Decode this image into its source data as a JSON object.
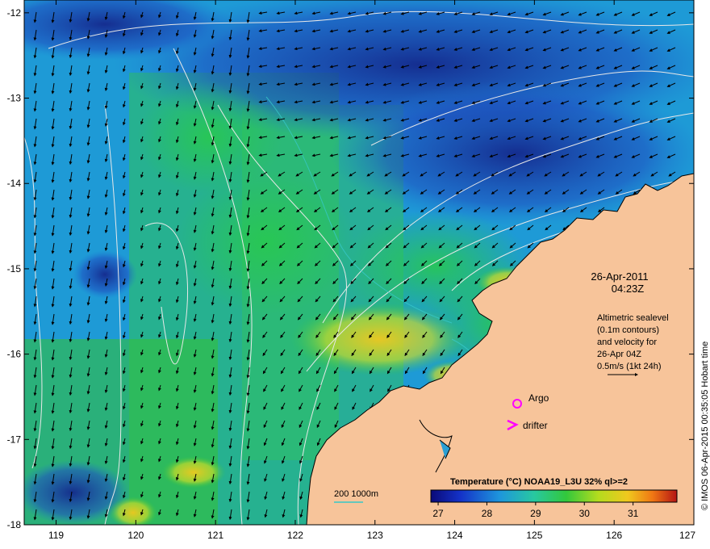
{
  "map": {
    "lon_ticks": [
      "119",
      "120",
      "121",
      "122",
      "123",
      "124",
      "125",
      "126",
      "127"
    ],
    "lat_ticks": [
      "-12",
      "-13",
      "-14",
      "-15",
      "-16",
      "-17",
      "-18"
    ],
    "lon_range": [
      118.6,
      127.0
    ],
    "lat_range": [
      -18.0,
      -11.85
    ]
  },
  "header": {
    "date": "26-Apr-2011",
    "time": "04:23Z"
  },
  "info": {
    "line1": "Altimetric sealevel",
    "line2": "(0.1m contours)",
    "line3": "and velocity for",
    "line4": "26-Apr 04Z",
    "line5": "0.5m/s (1kt 24h)"
  },
  "legend_markers": {
    "argo": "Argo",
    "drifter": "drifter"
  },
  "isobath": {
    "label": "200  1000m"
  },
  "colorbar": {
    "title": "Temperature (°C) NOAA19_L3U 32% ql>=2",
    "ticks": [
      "27",
      "28",
      "29",
      "30",
      "31"
    ],
    "range": [
      26.85,
      31.9
    ]
  },
  "stamp": {
    "text": "© IMOS 06-Apr-2015 00:35:05 Hobart time"
  },
  "colors": {
    "land": "#f7c49a",
    "sst_cold": "#14288c",
    "sst_mid": "#28b46e",
    "sst_warm": "#f0c81e",
    "contour": "#e6e6e6",
    "isobath_200": "#37c8c8",
    "marker": "#ff00ff"
  }
}
